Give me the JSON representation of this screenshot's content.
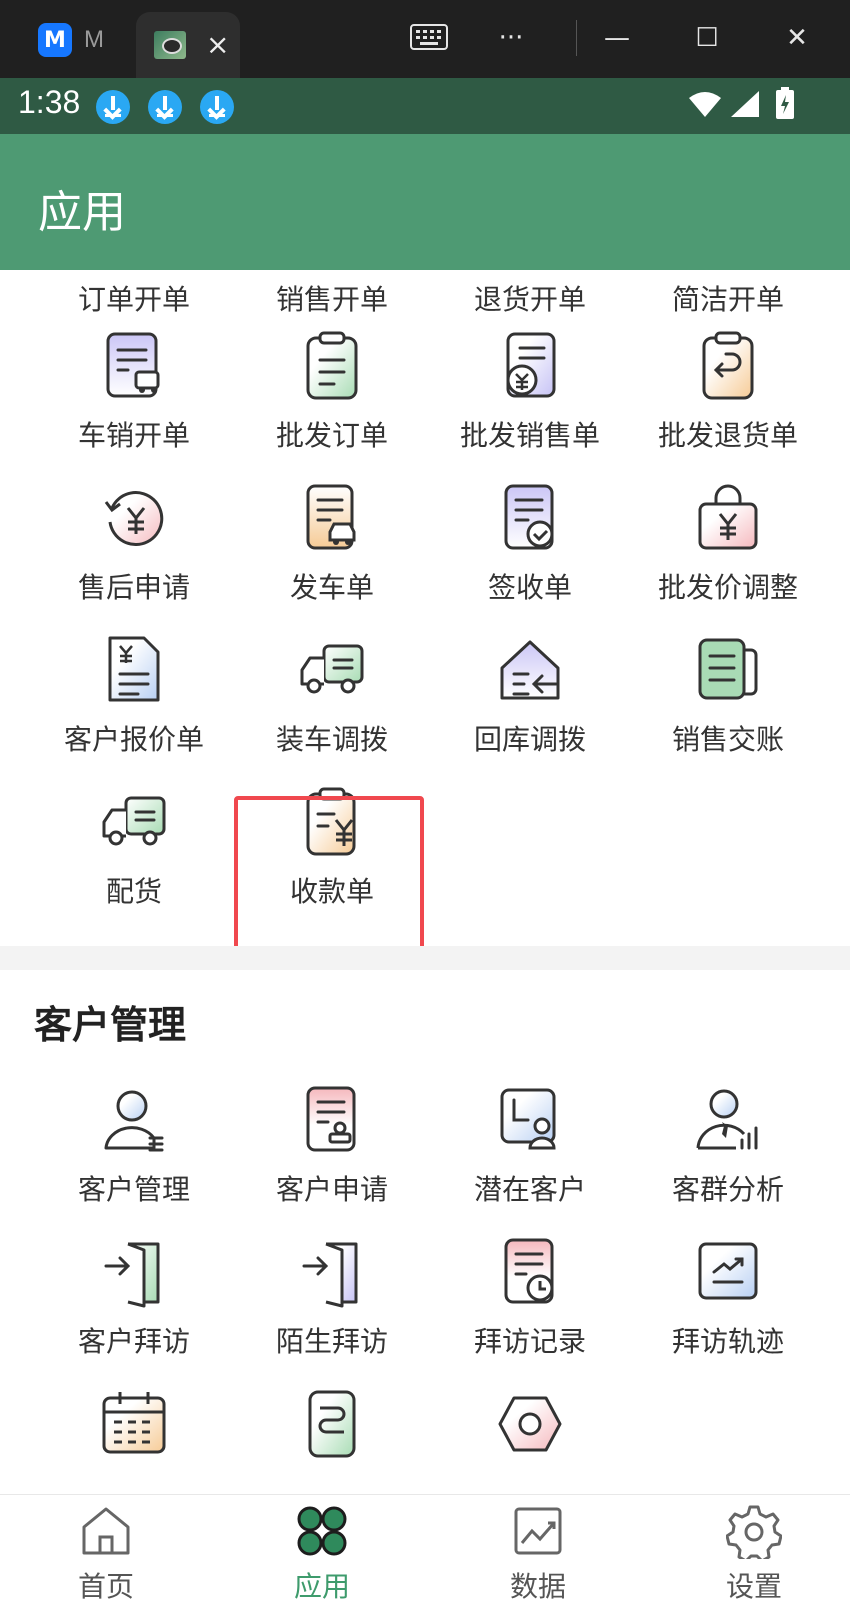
{
  "browser": {
    "tab1_label": "M",
    "tab2_close": "×",
    "more": "···",
    "minimize": "—",
    "maximize": "☐",
    "close": "✕"
  },
  "status_bar": {
    "time": "1:38"
  },
  "header": {
    "title": "应用"
  },
  "sales_partial_row": [
    "订单开单",
    "销售开单",
    "退货开单",
    "简洁开单"
  ],
  "sales_items": [
    {
      "label": "车销开单",
      "icon": "document-truck-icon"
    },
    {
      "label": "批发订单",
      "icon": "clipboard-icon"
    },
    {
      "label": "批发销售单",
      "icon": "document-yuan-icon"
    },
    {
      "label": "批发退货单",
      "icon": "clipboard-return-icon"
    },
    {
      "label": "售后申请",
      "icon": "yuan-refund-icon"
    },
    {
      "label": "发车单",
      "icon": "document-car-icon"
    },
    {
      "label": "签收单",
      "icon": "document-check-icon"
    },
    {
      "label": "批发价调整",
      "icon": "bag-yuan-icon"
    },
    {
      "label": "客户报价单",
      "icon": "price-sheet-icon"
    },
    {
      "label": "装车调拨",
      "icon": "truck-icon"
    },
    {
      "label": "回库调拨",
      "icon": "warehouse-return-icon"
    },
    {
      "label": "销售交账",
      "icon": "ledger-icon"
    },
    {
      "label": "配货",
      "icon": "delivery-truck-icon"
    },
    {
      "label": "收款单",
      "icon": "receipt-yuan-icon"
    }
  ],
  "customer_section": {
    "title": "客户管理",
    "items": [
      {
        "label": "客户管理",
        "icon": "user-list-icon"
      },
      {
        "label": "客户申请",
        "icon": "document-stamp-icon"
      },
      {
        "label": "潜在客户",
        "icon": "potential-customer-icon"
      },
      {
        "label": "客群分析",
        "icon": "user-chart-icon"
      },
      {
        "label": "客户拜访",
        "icon": "door-enter-icon"
      },
      {
        "label": "陌生拜访",
        "icon": "door-enter-icon"
      },
      {
        "label": "拜访记录",
        "icon": "document-clock-icon"
      },
      {
        "label": "拜访轨迹",
        "icon": "trend-monitor-icon"
      },
      {
        "label": "",
        "icon": "calendar-icon"
      },
      {
        "label": "",
        "icon": "route-icon"
      },
      {
        "label": "",
        "icon": "hexagon-icon"
      }
    ]
  },
  "bottom_nav": [
    {
      "label": "首页",
      "icon": "home-icon"
    },
    {
      "label": "应用",
      "icon": "apps-icon",
      "active": true
    },
    {
      "label": "数据",
      "icon": "chart-icon"
    },
    {
      "label": "设置",
      "icon": "gear-icon"
    }
  ],
  "colors": {
    "header": "#4e9a73",
    "status_bar": "#2f5a44",
    "accent": "#3e9b6c",
    "highlight_border": "#f0484e",
    "tint_purple": "#c9c5f3",
    "tint_green": "#b7e0c3",
    "tint_orange": "#f6cf9f",
    "tint_pink": "#f6c7c9",
    "tint_blue": "#bcd3f2"
  }
}
